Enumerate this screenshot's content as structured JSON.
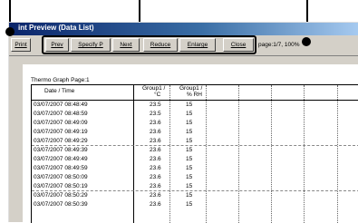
{
  "title": "int Preview (Data List)",
  "toolbar": {
    "print": "Print",
    "prev": "Prev",
    "specify_p": "Specify P",
    "next": "Next",
    "reduce": "Reduce",
    "enlarge": "Enlarge",
    "close": "Close"
  },
  "page_info": "page:1/7, 100%",
  "graph_title": "Thermo Graph  Page:1",
  "columns": [
    {
      "line1": "Date / Time",
      "line2": ""
    },
    {
      "line1": "Group1  /",
      "line2": "°C"
    },
    {
      "line1": "Group1  /",
      "line2": "% RH"
    }
  ],
  "rows": [
    {
      "time": "03/07/2007 08:48:49",
      "temp": "23.5",
      "rh": "15"
    },
    {
      "time": "03/07/2007 08:48:59",
      "temp": "23.5",
      "rh": "15"
    },
    {
      "time": "03/07/2007 08:49:09",
      "temp": "23.6",
      "rh": "15"
    },
    {
      "time": "03/07/2007 08:49:19",
      "temp": "23.6",
      "rh": "15"
    },
    {
      "time": "03/07/2007 08:49:29",
      "temp": "23.6",
      "rh": "15"
    },
    {
      "time": "03/07/2007 08:49:39",
      "temp": "23.6",
      "rh": "15"
    },
    {
      "time": "03/07/2007 08:49:49",
      "temp": "23.6",
      "rh": "15"
    },
    {
      "time": "03/07/2007 08:49:59",
      "temp": "23.6",
      "rh": "15"
    },
    {
      "time": "03/07/2007 08:50:09",
      "temp": "23.6",
      "rh": "15"
    },
    {
      "time": "03/07/2007 08:50:19",
      "temp": "23.6",
      "rh": "15"
    },
    {
      "time": "03/07/2007 08:50:29",
      "temp": "23.6",
      "rh": "15"
    },
    {
      "time": "03/07/2007 08:50:39",
      "temp": "23.6",
      "rh": "15"
    }
  ]
}
